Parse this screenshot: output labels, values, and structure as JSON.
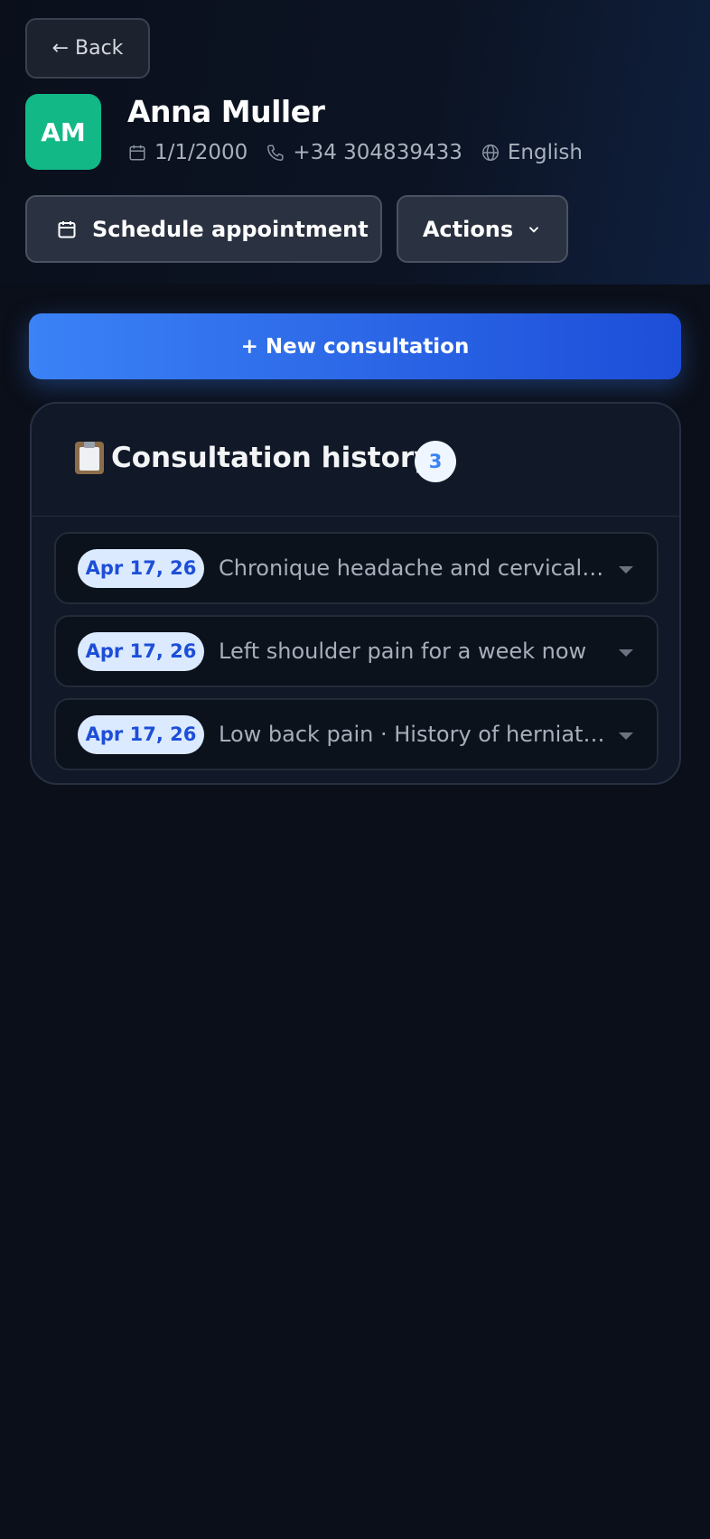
{
  "header": {
    "back_label": "← Back",
    "avatar_initials": "AM",
    "patient_name": "Anna Muller",
    "dob": "1/1/2000",
    "phone": "+34 304839433",
    "language": "English",
    "schedule_label": "Schedule appointment",
    "actions_label": "Actions"
  },
  "main": {
    "new_consultation_label": "+ New consultation",
    "history": {
      "title": "Consultation history",
      "count": "3",
      "items": [
        {
          "date": "Apr 17, 26",
          "summary": "Chronique headache and cervical…"
        },
        {
          "date": "Apr 17, 26",
          "summary": "Left shoulder pain for a week now"
        },
        {
          "date": "Apr 17, 26",
          "summary": "Low back pain · History of herniate…"
        }
      ]
    }
  },
  "colors": {
    "accent": "#3b82f6",
    "avatar_bg": "#12b886",
    "background": "#0b0f19"
  },
  "icons": [
    "calendar-icon",
    "phone-icon",
    "globe-icon",
    "chevron-down-icon",
    "clipboard-icon"
  ]
}
